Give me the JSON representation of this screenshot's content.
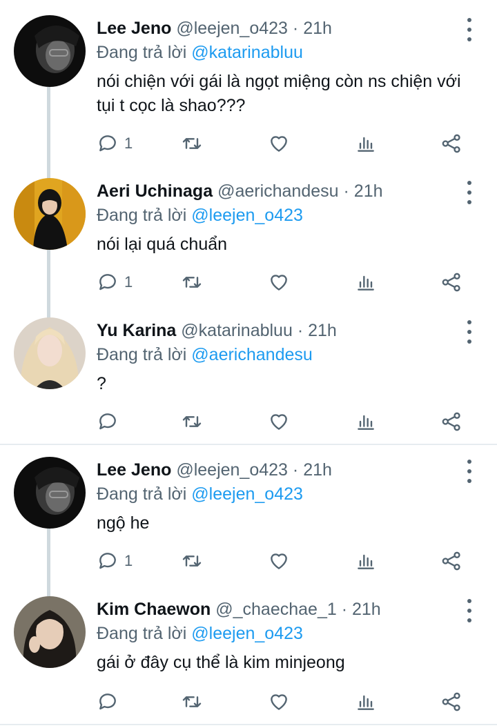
{
  "colors": {
    "accent": "#1d9bf0",
    "muted": "#536471",
    "text": "#0f1419",
    "thread_line": "#cfd9de"
  },
  "tweets": [
    {
      "name": "Lee Jeno",
      "handle": "@leejen_o423",
      "dot": "·",
      "time": "21h",
      "reply_prefix": "Đang trả lời",
      "reply_to": "@katarinabluu",
      "text": "nói chiện với gái là ngọt miệng còn ns chiện với tụi t cọc là shao???",
      "reply_count": "1",
      "avatar_icon": "user-avatar-dark"
    },
    {
      "name": "Aeri Uchinaga",
      "handle": "@aerichandesu",
      "dot": "·",
      "time": "21h",
      "reply_prefix": "Đang trả lời",
      "reply_to": "@leejen_o423",
      "text": "nói lại quá chuẩn",
      "reply_count": "1",
      "avatar_icon": "user-avatar-yellow"
    },
    {
      "name": "Yu Karina",
      "handle": "@katarinabluu",
      "dot": "·",
      "time": "21h",
      "reply_prefix": "Đang trả lời",
      "reply_to": "@aerichandesu",
      "text": "?",
      "reply_count": "",
      "avatar_icon": "user-avatar-blonde"
    },
    {
      "name": "Lee Jeno",
      "handle": "@leejen_o423",
      "dot": "·",
      "time": "21h",
      "reply_prefix": "Đang trả lời",
      "reply_to": "@leejen_o423",
      "text": "ngộ he",
      "reply_count": "1",
      "avatar_icon": "user-avatar-dark"
    },
    {
      "name": "Kim Chaewon",
      "handle": "@_chaechae_1",
      "dot": "·",
      "time": "21h",
      "reply_prefix": "Đang trả lời",
      "reply_to": "@leejen_o423",
      "text": "gái ở đây cụ thể là kim minjeong",
      "reply_count": "",
      "avatar_icon": "user-avatar-gray"
    }
  ]
}
